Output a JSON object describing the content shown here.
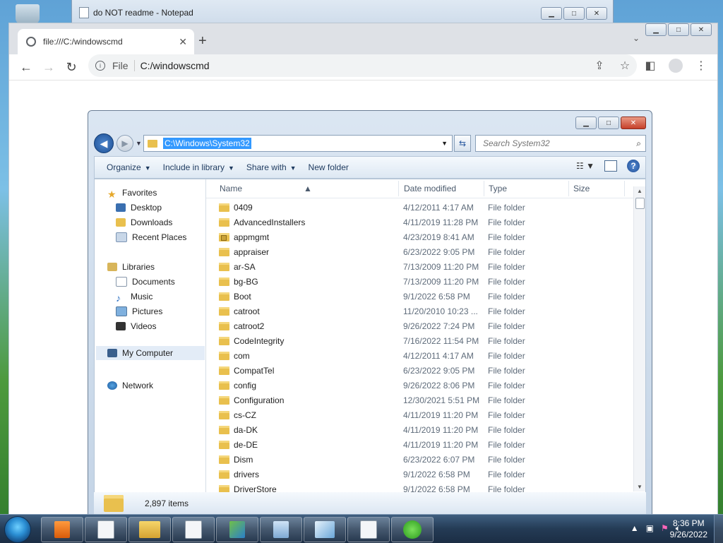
{
  "notepad": {
    "title": "do NOT readme - Notepad"
  },
  "browser": {
    "tab_title": "file:///C:/windowscmd",
    "scheme_label": "File",
    "url": "C:/windowscmd"
  },
  "explorer": {
    "address": "C:\\Windows\\System32",
    "search_placeholder": "Search System32",
    "commands": [
      "Organize",
      "Include in library",
      "Share with",
      "New folder"
    ],
    "columns": {
      "name": "Name",
      "date": "Date modified",
      "type": "Type",
      "size": "Size"
    },
    "nav": {
      "favorites": "Favorites",
      "desktop": "Desktop",
      "downloads": "Downloads",
      "recent": "Recent Places",
      "libraries": "Libraries",
      "documents": "Documents",
      "music": "Music",
      "pictures": "Pictures",
      "videos": "Videos",
      "computer": "My Computer",
      "network": "Network"
    },
    "files": [
      {
        "name": "0409",
        "date": "4/12/2011 4:17 AM",
        "type": "File folder"
      },
      {
        "name": "AdvancedInstallers",
        "date": "4/11/2019 11:28 PM",
        "type": "File folder"
      },
      {
        "name": "appmgmt",
        "date": "4/23/2019 8:41 AM",
        "type": "File folder",
        "locked": true
      },
      {
        "name": "appraiser",
        "date": "6/23/2022 9:05 PM",
        "type": "File folder"
      },
      {
        "name": "ar-SA",
        "date": "7/13/2009 11:20 PM",
        "type": "File folder"
      },
      {
        "name": "bg-BG",
        "date": "7/13/2009 11:20 PM",
        "type": "File folder"
      },
      {
        "name": "Boot",
        "date": "9/1/2022 6:58 PM",
        "type": "File folder"
      },
      {
        "name": "catroot",
        "date": "11/20/2010 10:23 ...",
        "type": "File folder"
      },
      {
        "name": "catroot2",
        "date": "9/26/2022 7:24 PM",
        "type": "File folder"
      },
      {
        "name": "CodeIntegrity",
        "date": "7/16/2022 11:54 PM",
        "type": "File folder"
      },
      {
        "name": "com",
        "date": "4/12/2011 4:17 AM",
        "type": "File folder"
      },
      {
        "name": "CompatTel",
        "date": "6/23/2022 9:05 PM",
        "type": "File folder"
      },
      {
        "name": "config",
        "date": "9/26/2022 8:06 PM",
        "type": "File folder"
      },
      {
        "name": "Configuration",
        "date": "12/30/2021 5:51 PM",
        "type": "File folder"
      },
      {
        "name": "cs-CZ",
        "date": "4/11/2019 11:20 PM",
        "type": "File folder"
      },
      {
        "name": "da-DK",
        "date": "4/11/2019 11:20 PM",
        "type": "File folder"
      },
      {
        "name": "de-DE",
        "date": "4/11/2019 11:20 PM",
        "type": "File folder"
      },
      {
        "name": "Dism",
        "date": "6/23/2022 6:07 PM",
        "type": "File folder"
      },
      {
        "name": "drivers",
        "date": "9/1/2022 6:58 PM",
        "type": "File folder"
      },
      {
        "name": "DriverStore",
        "date": "9/1/2022 6:58 PM",
        "type": "File folder"
      }
    ],
    "item_count": "2,897 items"
  },
  "taskbar": {
    "time": "8:36 PM",
    "date": "9/26/2022"
  }
}
